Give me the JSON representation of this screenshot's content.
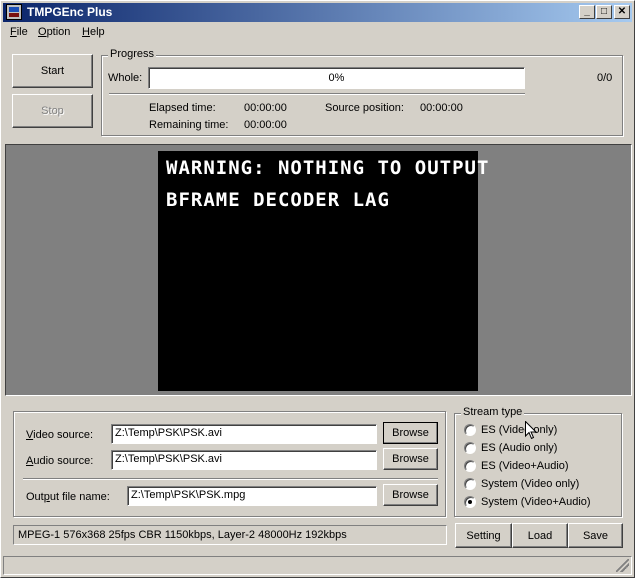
{
  "window": {
    "title": "TMPGEnc Plus",
    "controls": {
      "minimize": "_",
      "maximize": "□",
      "close": "✕"
    }
  },
  "menu": {
    "items": [
      {
        "label_first": "F",
        "label_rest": "ile"
      },
      {
        "label_first": "O",
        "label_rest": "ption"
      },
      {
        "label_first": "H",
        "label_rest": "elp"
      }
    ]
  },
  "controls": {
    "start_label": "Start",
    "stop_label": "Stop"
  },
  "progress": {
    "group_label": "Progress",
    "whole_label": "Whole:",
    "percent_text": "0%",
    "percent_value": 0,
    "count": "0/0",
    "elapsed_label": "Elapsed time:",
    "elapsed_value": "00:00:00",
    "remaining_label": "Remaining time:",
    "remaining_value": "00:00:00",
    "source_position_label": "Source position:",
    "source_position_value": "00:00:00"
  },
  "preview": {
    "lines": [
      "WARNING: NOTHING TO OUTPUT",
      "BFRAME DECODER LAG"
    ]
  },
  "sources": {
    "video_label_first": "V",
    "video_label_rest": "ideo source:",
    "video_value": "Z:\\Temp\\PSK\\PSK.avi",
    "audio_label_first": "A",
    "audio_label_rest": "udio source:",
    "audio_value": "Z:\\Temp\\PSK\\PSK.avi",
    "output_label_pre": "Out",
    "output_label_first": "p",
    "output_label_rest": "ut file name:",
    "output_value": "Z:\\Temp\\PSK\\PSK.mpg",
    "browse_label": "Browse"
  },
  "stream_type": {
    "group_label": "Stream type",
    "options": [
      {
        "label": "ES (Video only)",
        "selected": false
      },
      {
        "label": "ES (Audio only)",
        "selected": false
      },
      {
        "label": "ES (Video+Audio)",
        "selected": false
      },
      {
        "label": "System (Video only)",
        "selected": false
      },
      {
        "label": "System (Video+Audio)",
        "selected": true
      }
    ]
  },
  "status": {
    "text": "MPEG-1 576x368 25fps CBR 1150kbps,  Layer-2 48000Hz 192kbps"
  },
  "bottom_buttons": {
    "setting_label": "Setting",
    "load_label": "Load",
    "save_label": "Save"
  },
  "icons": {
    "app": "tmpgenc-app-icon",
    "cursor": "mouse-pointer-icon",
    "grip": "resize-grip-icon"
  }
}
